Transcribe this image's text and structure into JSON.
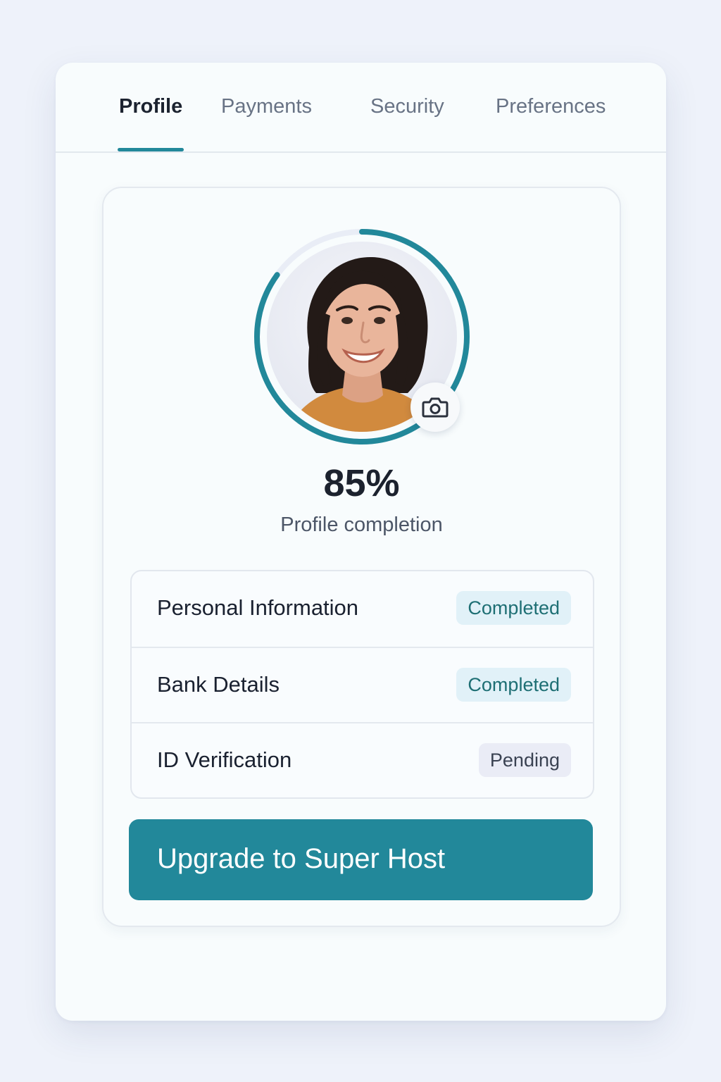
{
  "tabs": [
    {
      "label": "Profile",
      "active": true
    },
    {
      "label": "Payments",
      "active": false
    },
    {
      "label": "Security",
      "active": false
    },
    {
      "label": "Preferences",
      "active": false
    }
  ],
  "profile": {
    "completion_percent": 85,
    "completion_text": "85%",
    "completion_label": "Profile completion",
    "avatar_icon": "user-photo",
    "camera_icon": "camera-icon"
  },
  "checklist": [
    {
      "label": "Personal Information",
      "status": "Completed"
    },
    {
      "label": "Bank Details",
      "status": "Completed"
    },
    {
      "label": "ID Verification",
      "status": "Pending"
    }
  ],
  "cta": {
    "label": "Upgrade to Super Host"
  },
  "colors": {
    "accent": "#22889a",
    "ring_track": "#e9edf6",
    "completed_bg": "#e1f1f8",
    "completed_text": "#1e6f74",
    "pending_bg": "#eaecf6",
    "pending_text": "#3a4252"
  }
}
